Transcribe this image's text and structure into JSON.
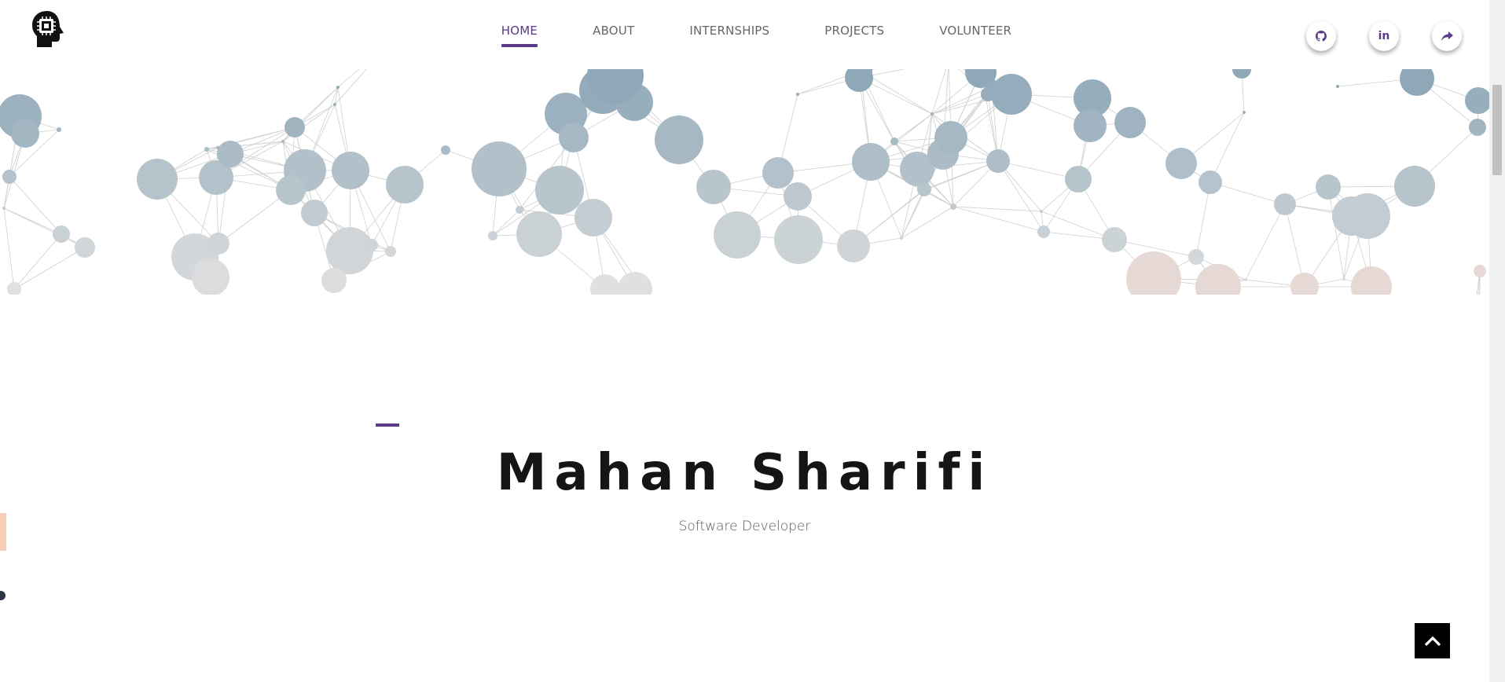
{
  "nav": {
    "items": [
      {
        "label": "HOME",
        "active": true
      },
      {
        "label": "ABOUT",
        "active": false
      },
      {
        "label": "INTERNSHIPS",
        "active": false
      },
      {
        "label": "PROJECTS",
        "active": false
      },
      {
        "label": "VOLUNTEER",
        "active": false
      }
    ]
  },
  "logo": {
    "icon": "head-chip-icon"
  },
  "social": [
    {
      "icon": "github-icon"
    },
    {
      "icon": "linkedin-icon",
      "label": "in"
    },
    {
      "icon": "share-icon"
    }
  ],
  "hero": {
    "name": "Mahan Sharifi",
    "role": "Software Developer"
  },
  "scroll_top": {
    "icon": "chevron-up-icon"
  },
  "colors": {
    "accent": "#5b3a87",
    "particle": "#8ea8b8",
    "particle_light": "#dcdcdc",
    "particle_warm": "#e6d8d4",
    "text_dark": "#151515"
  }
}
